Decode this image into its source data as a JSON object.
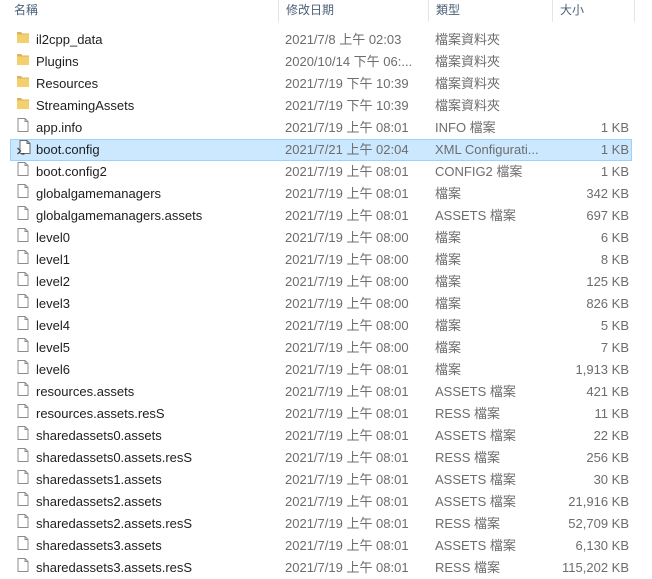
{
  "columns": {
    "name": "名稱",
    "modified": "修改日期",
    "type": "類型",
    "size": "大小"
  },
  "files": [
    {
      "icon": "folder-icon",
      "name": "il2cpp_data",
      "modified": "2021/7/8 上午 02:03",
      "type": "檔案資料夾",
      "size": ""
    },
    {
      "icon": "folder-icon",
      "name": "Plugins",
      "modified": "2020/10/14 下午 06:...",
      "type": "檔案資料夾",
      "size": ""
    },
    {
      "icon": "folder-icon",
      "name": "Resources",
      "modified": "2021/7/19 下午 10:39",
      "type": "檔案資料夾",
      "size": ""
    },
    {
      "icon": "folder-icon",
      "name": "StreamingAssets",
      "modified": "2021/7/19 下午 10:39",
      "type": "檔案資料夾",
      "size": ""
    },
    {
      "icon": "file-icon",
      "name": "app.info",
      "modified": "2021/7/19 上午 08:01",
      "type": "INFO 檔案",
      "size": "1 KB"
    },
    {
      "icon": "config-file-icon",
      "name": "boot.config",
      "modified": "2021/7/21 上午 02:04",
      "type": "XML Configurati...",
      "size": "1 KB",
      "selected": true
    },
    {
      "icon": "file-icon",
      "name": "boot.config2",
      "modified": "2021/7/19 上午 08:01",
      "type": "CONFIG2 檔案",
      "size": "1 KB"
    },
    {
      "icon": "file-icon",
      "name": "globalgamemanagers",
      "modified": "2021/7/19 上午 08:01",
      "type": "檔案",
      "size": "342 KB"
    },
    {
      "icon": "file-icon",
      "name": "globalgamemanagers.assets",
      "modified": "2021/7/19 上午 08:01",
      "type": "ASSETS 檔案",
      "size": "697 KB"
    },
    {
      "icon": "file-icon",
      "name": "level0",
      "modified": "2021/7/19 上午 08:00",
      "type": "檔案",
      "size": "6 KB"
    },
    {
      "icon": "file-icon",
      "name": "level1",
      "modified": "2021/7/19 上午 08:00",
      "type": "檔案",
      "size": "8 KB"
    },
    {
      "icon": "file-icon",
      "name": "level2",
      "modified": "2021/7/19 上午 08:00",
      "type": "檔案",
      "size": "125 KB"
    },
    {
      "icon": "file-icon",
      "name": "level3",
      "modified": "2021/7/19 上午 08:00",
      "type": "檔案",
      "size": "826 KB"
    },
    {
      "icon": "file-icon",
      "name": "level4",
      "modified": "2021/7/19 上午 08:00",
      "type": "檔案",
      "size": "5 KB"
    },
    {
      "icon": "file-icon",
      "name": "level5",
      "modified": "2021/7/19 上午 08:00",
      "type": "檔案",
      "size": "7 KB"
    },
    {
      "icon": "file-icon",
      "name": "level6",
      "modified": "2021/7/19 上午 08:01",
      "type": "檔案",
      "size": "1,913 KB"
    },
    {
      "icon": "file-icon",
      "name": "resources.assets",
      "modified": "2021/7/19 上午 08:01",
      "type": "ASSETS 檔案",
      "size": "421 KB"
    },
    {
      "icon": "file-icon",
      "name": "resources.assets.resS",
      "modified": "2021/7/19 上午 08:01",
      "type": "RESS 檔案",
      "size": "11 KB"
    },
    {
      "icon": "file-icon",
      "name": "sharedassets0.assets",
      "modified": "2021/7/19 上午 08:01",
      "type": "ASSETS 檔案",
      "size": "22 KB"
    },
    {
      "icon": "file-icon",
      "name": "sharedassets0.assets.resS",
      "modified": "2021/7/19 上午 08:01",
      "type": "RESS 檔案",
      "size": "256 KB"
    },
    {
      "icon": "file-icon",
      "name": "sharedassets1.assets",
      "modified": "2021/7/19 上午 08:01",
      "type": "ASSETS 檔案",
      "size": "30 KB"
    },
    {
      "icon": "file-icon",
      "name": "sharedassets2.assets",
      "modified": "2021/7/19 上午 08:01",
      "type": "ASSETS 檔案",
      "size": "21,916 KB"
    },
    {
      "icon": "file-icon",
      "name": "sharedassets2.assets.resS",
      "modified": "2021/7/19 上午 08:01",
      "type": "RESS 檔案",
      "size": "52,709 KB"
    },
    {
      "icon": "file-icon",
      "name": "sharedassets3.assets",
      "modified": "2021/7/19 上午 08:01",
      "type": "ASSETS 檔案",
      "size": "6,130 KB"
    },
    {
      "icon": "file-icon",
      "name": "sharedassets3.assets.resS",
      "modified": "2021/7/19 上午 08:01",
      "type": "RESS 檔案",
      "size": "115,202 KB"
    }
  ],
  "colors": {
    "selection_bg": "#cce8ff",
    "selection_border": "#99d1ff",
    "folder": "#dcb35c",
    "header_text": "#4c607a"
  }
}
